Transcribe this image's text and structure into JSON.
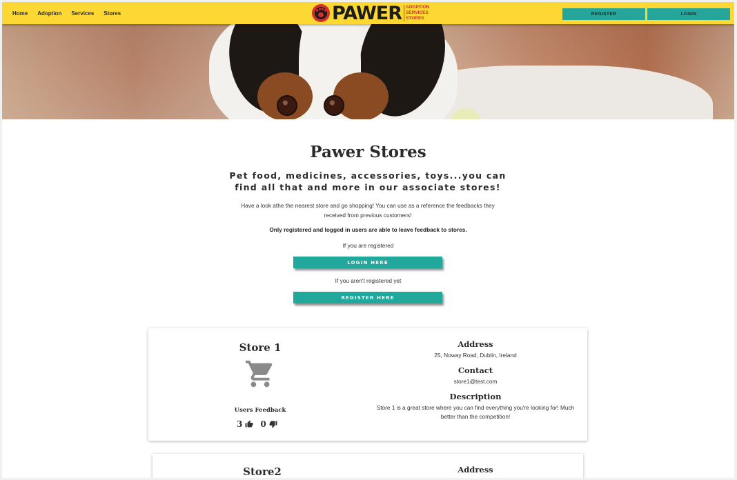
{
  "nav": {
    "links": [
      "Home",
      "Adoption",
      "Services",
      "Stores"
    ],
    "logo_word": "PAWER",
    "logo_tags": [
      "ADOPTION",
      "SERVICES",
      "STORES"
    ],
    "register_label": "REGISTER",
    "login_label": "LOGIN"
  },
  "colors": {
    "nav_bg": "#fdd835",
    "accent": "#26a69a",
    "brand_red": "#d32f2f"
  },
  "main": {
    "title": "Pawer Stores",
    "subtitle": "Pet food, medicines, accessories, toys...you can find all that and more in our associate stores!",
    "intro": "Have a look athe the nearest store and go shopping! You can use as a reference the feedbacks they received from previous customers!",
    "note": "Only registered and logged in users are able to leave feedback to stores.",
    "if_registered": "If you are registered",
    "login_here": "LOGIN HERE",
    "if_not_registered": "If you aren't registered yet",
    "register_here": "REGISTER HERE"
  },
  "stores": [
    {
      "name": "Store 1",
      "icon": "shopping-cart-icon",
      "feedback_title": "Users Feedback",
      "likes": "3",
      "dislikes": "0",
      "address_title": "Address",
      "address": "25, Noway Road, Dublin, Ireland",
      "contact_title": "Contact",
      "contact": "store1@test.com",
      "description_title": "Description",
      "description": "Store 1 is a great store where you can find everything you're looking for! Much better than the competition!"
    },
    {
      "name": "Store2",
      "address_title": "Address"
    }
  ]
}
